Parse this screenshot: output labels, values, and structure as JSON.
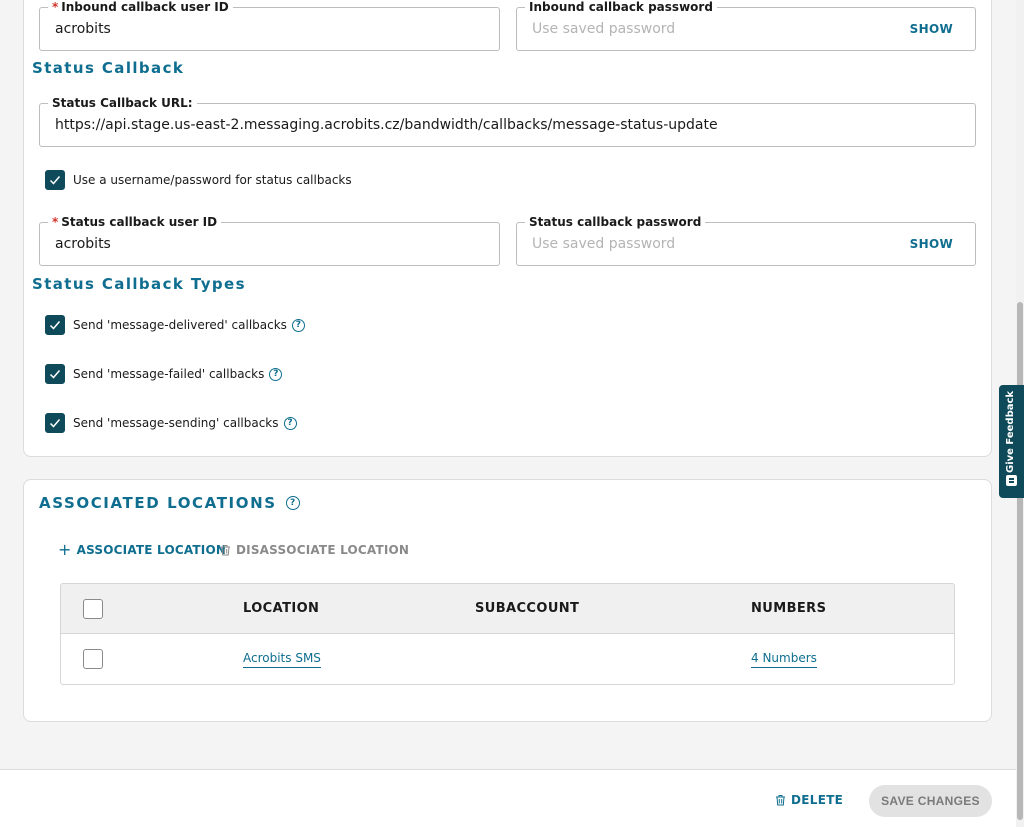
{
  "inbound": {
    "user_id_label": "Inbound callback user ID",
    "user_id_value": "acrobits",
    "password_label": "Inbound callback password",
    "password_placeholder": "Use saved password",
    "show_label": "SHOW"
  },
  "status_callback": {
    "section_title": "Status Callback",
    "url_label": "Status Callback URL:",
    "url_value": "https://api.stage.us-east-2.messaging.acrobits.cz/bandwidth/callbacks/message-status-update",
    "use_credentials_label": "Use a username/password for status callbacks",
    "use_credentials_checked": true,
    "user_id_label": "Status callback user ID",
    "user_id_value": "acrobits",
    "password_label": "Status callback password",
    "password_placeholder": "Use saved password",
    "show_label": "SHOW"
  },
  "callback_types": {
    "section_title": "Status Callback Types",
    "items": [
      {
        "label": "Send 'message-delivered' callbacks",
        "checked": true
      },
      {
        "label": "Send 'message-failed' callbacks",
        "checked": true
      },
      {
        "label": "Send 'message-sending' callbacks",
        "checked": true
      }
    ]
  },
  "associated_locations": {
    "title": "ASSOCIATED LOCATIONS",
    "associate_label": "ASSOCIATE LOCATION",
    "disassociate_label": "DISASSOCIATE LOCATION",
    "columns": [
      "LOCATION",
      "SUBACCOUNT",
      "NUMBERS"
    ],
    "rows": [
      {
        "location": "Acrobits SMS",
        "subaccount": "",
        "numbers": "4 Numbers"
      }
    ]
  },
  "footer": {
    "delete_label": "DELETE",
    "save_label": "SAVE CHANGES"
  },
  "feedback": {
    "label": "Give Feedback"
  },
  "icons": {
    "help": "question-circle-icon",
    "check": "checkmark-icon",
    "trash": "trash-icon",
    "plus": "plus-icon",
    "feedback": "feedback-icon"
  },
  "colors": {
    "accent": "#0f6e8f",
    "checkbox": "#0e4a5a",
    "required": "#d0342c"
  }
}
